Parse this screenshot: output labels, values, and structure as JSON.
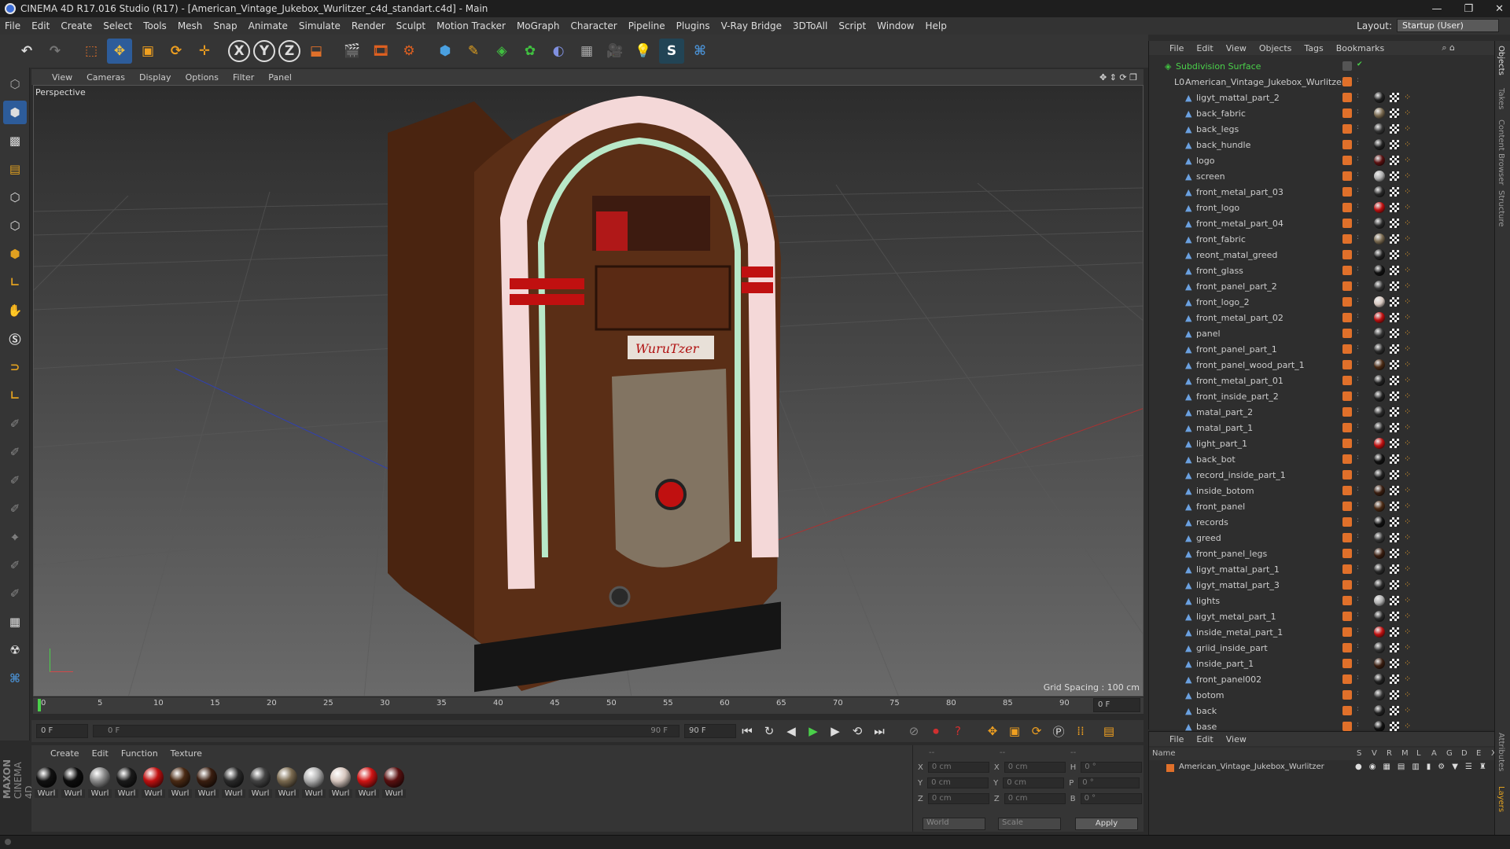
{
  "window": {
    "title": "CINEMA 4D R17.016 Studio (R17) - [American_Vintage_Jukebox_Wurlitzer_c4d_standart.c4d] - Main",
    "min": "—",
    "max": "❐",
    "close": "✕"
  },
  "menu": [
    "File",
    "Edit",
    "Create",
    "Select",
    "Tools",
    "Mesh",
    "Snap",
    "Animate",
    "Simulate",
    "Render",
    "Sculpt",
    "Motion Tracker",
    "MoGraph",
    "Character",
    "Pipeline",
    "Plugins",
    "V-Ray Bridge",
    "3DToAll",
    "Script",
    "Window",
    "Help"
  ],
  "layout": {
    "label": "Layout:",
    "value": "Startup (User)"
  },
  "viewport": {
    "menu": [
      "View",
      "Cameras",
      "Display",
      "Options",
      "Filter",
      "Panel"
    ],
    "camera": "Perspective",
    "grid_spacing": "Grid Spacing : 100 cm",
    "logo_text": "WuruTzer"
  },
  "timeline": {
    "ticks": [
      "0",
      "5",
      "10",
      "15",
      "20",
      "25",
      "30",
      "35",
      "40",
      "45",
      "50",
      "55",
      "60",
      "65",
      "70",
      "75",
      "80",
      "85",
      "90"
    ],
    "end_frame": "0 F"
  },
  "playback": {
    "current": "0 F",
    "range_start": "0 F",
    "range_end": "90 F",
    "max": "90 F"
  },
  "materials": {
    "menu": [
      "Create",
      "Edit",
      "Function",
      "Texture"
    ],
    "items": [
      {
        "label": "Wurl",
        "color": "#111111"
      },
      {
        "label": "Wurl",
        "color": "#0d0d0d"
      },
      {
        "label": "Wurl",
        "color": "#8a8a8a"
      },
      {
        "label": "Wurl",
        "color": "#1a1a1a"
      },
      {
        "label": "Wurl",
        "color": "#c01010"
      },
      {
        "label": "Wurl",
        "color": "#4a2a14"
      },
      {
        "label": "Wurl",
        "color": "#3a1e10"
      },
      {
        "label": "Wurl",
        "color": "#2a2a2a"
      },
      {
        "label": "Wurl",
        "color": "#444444"
      },
      {
        "label": "Wurl",
        "color": "#7a6a50"
      },
      {
        "label": "Wurl",
        "color": "#b0b0b0"
      },
      {
        "label": "Wurl",
        "color": "#d8c8c0"
      },
      {
        "label": "Wurl",
        "color": "#d01414"
      },
      {
        "label": "Wurl",
        "color": "#5a1010"
      }
    ]
  },
  "coords": {
    "rows": [
      {
        "a": "X",
        "av": "0 cm",
        "b": "X",
        "bv": "0 cm",
        "c": "H",
        "cv": "0 °"
      },
      {
        "a": "Y",
        "av": "0 cm",
        "b": "Y",
        "bv": "0 cm",
        "c": "P",
        "cv": "0 °"
      },
      {
        "a": "Z",
        "av": "0 cm",
        "b": "Z",
        "bv": "0 cm",
        "c": "B",
        "cv": "0 °"
      }
    ],
    "world": "World",
    "scale": "Scale",
    "apply": "Apply",
    "dash1": "--",
    "dash2": "--",
    "dash3": "--"
  },
  "objects": {
    "menu": [
      "File",
      "Edit",
      "View",
      "Objects",
      "Tags",
      "Bookmarks"
    ],
    "root": "Subdivision Surface",
    "parent": "American_Vintage_Jukebox_Wurlitzer",
    "children": [
      {
        "name": "ligyt_mattal_part_2",
        "mat": "#222"
      },
      {
        "name": "back_fabric",
        "mat": "#7a6a50"
      },
      {
        "name": "back_legs",
        "mat": "#333"
      },
      {
        "name": "back_hundle",
        "mat": "#222"
      },
      {
        "name": "logo",
        "mat": "#5a1010"
      },
      {
        "name": "screen",
        "mat": "#b0b0b0"
      },
      {
        "name": "front_metal_part_03",
        "mat": "#2a2a2a"
      },
      {
        "name": "front_logo",
        "mat": "#c01010"
      },
      {
        "name": "front_metal_part_04",
        "mat": "#2a2a2a"
      },
      {
        "name": "front_fabric",
        "mat": "#7a6a50"
      },
      {
        "name": "reont_matal_greed",
        "mat": "#222"
      },
      {
        "name": "front_glass",
        "mat": "#111"
      },
      {
        "name": "front_panel_part_2",
        "mat": "#333"
      },
      {
        "name": "front_logo_2",
        "mat": "#d8c8c0"
      },
      {
        "name": "front_metal_part_02",
        "mat": "#c01010"
      },
      {
        "name": "panel",
        "mat": "#333"
      },
      {
        "name": "front_panel_part_1",
        "mat": "#2a2a2a"
      },
      {
        "name": "front_panel_wood_part_1",
        "mat": "#4a2a14"
      },
      {
        "name": "front_metal_part_01",
        "mat": "#222"
      },
      {
        "name": "front_inside_part_2",
        "mat": "#222"
      },
      {
        "name": "matal_part_2",
        "mat": "#2a2a2a"
      },
      {
        "name": "matal_part_1",
        "mat": "#2a2a2a"
      },
      {
        "name": "light_part_1",
        "mat": "#c01010"
      },
      {
        "name": "back_bot",
        "mat": "#111"
      },
      {
        "name": "record_inside_part_1",
        "mat": "#222"
      },
      {
        "name": "inside_botom",
        "mat": "#3a1e10"
      },
      {
        "name": "front_panel",
        "mat": "#4a2a14"
      },
      {
        "name": "records",
        "mat": "#111"
      },
      {
        "name": "greed",
        "mat": "#333"
      },
      {
        "name": "front_panel_legs",
        "mat": "#3a1e10"
      },
      {
        "name": "ligyt_mattal_part_1",
        "mat": "#2a2a2a"
      },
      {
        "name": "ligyt_mattal_part_3",
        "mat": "#2a2a2a"
      },
      {
        "name": "lights",
        "mat": "#b0b0b0"
      },
      {
        "name": "ligyt_metal_part_1",
        "mat": "#2a2a2a"
      },
      {
        "name": "inside_metal_part_1",
        "mat": "#c01010"
      },
      {
        "name": "griid_inside_part",
        "mat": "#333"
      },
      {
        "name": "inside_part_1",
        "mat": "#3a1e10"
      },
      {
        "name": "front_panel002",
        "mat": "#222"
      },
      {
        "name": "botom",
        "mat": "#333"
      },
      {
        "name": "back",
        "mat": "#222"
      },
      {
        "name": "base",
        "mat": "#111"
      }
    ]
  },
  "layers": {
    "menu": [
      "File",
      "Edit",
      "View"
    ],
    "header_name": "Name",
    "columns": [
      "S",
      "V",
      "R",
      "M",
      "L",
      "A",
      "G",
      "D",
      "E",
      "X"
    ],
    "row": "American_Vintage_Jukebox_Wurlitzer"
  },
  "side_tabs": [
    "Objects",
    "Takes",
    "Content Browser",
    "Structure",
    "Attributes",
    "Layers"
  ],
  "brand": {
    "a": "MAXON",
    "b": "CINEMA 4D"
  },
  "colors": {
    "accent": "#2d5c9a",
    "tag_orange": "#e0702a",
    "selection_blue": "#3c6dd6"
  }
}
